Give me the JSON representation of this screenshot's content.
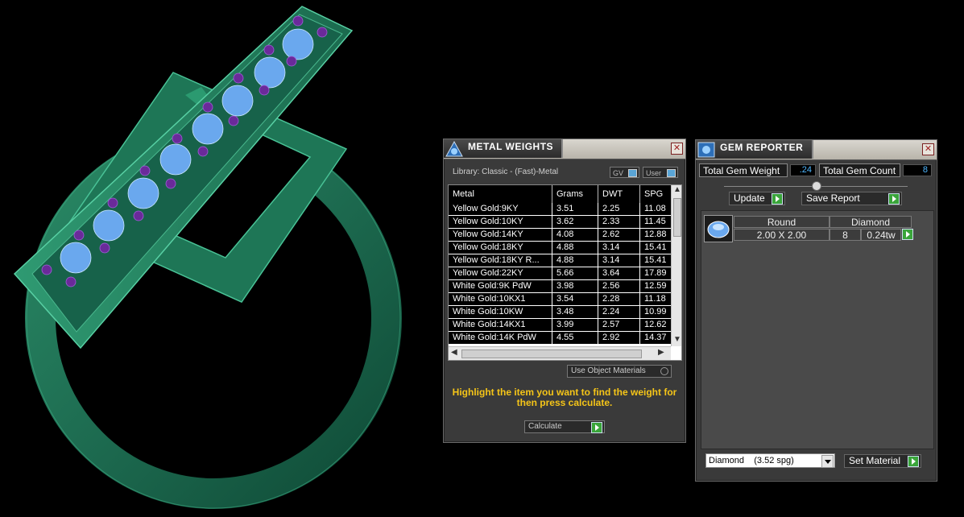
{
  "metal_panel": {
    "title": "METAL WEIGHTS",
    "library_label": "Library: Classic - (Fast)-Metal",
    "gv_toggle": "GV",
    "user_toggle": "User",
    "columns": [
      "Metal",
      "Grams",
      "DWT",
      "SPG"
    ],
    "rows": [
      [
        "Yellow Gold:9KY",
        "3.51",
        "2.25",
        "11.08"
      ],
      [
        "Yellow Gold:10KY",
        "3.62",
        "2.33",
        "11.45"
      ],
      [
        "Yellow Gold:14KY",
        "4.08",
        "2.62",
        "12.88"
      ],
      [
        "Yellow Gold:18KY",
        "4.88",
        "3.14",
        "15.41"
      ],
      [
        "Yellow Gold:18KY R...",
        "4.88",
        "3.14",
        "15.41"
      ],
      [
        "Yellow Gold:22KY",
        "5.66",
        "3.64",
        "17.89"
      ],
      [
        "White Gold:9K PdW",
        "3.98",
        "2.56",
        "12.59"
      ],
      [
        "White Gold:10KX1",
        "3.54",
        "2.28",
        "11.18"
      ],
      [
        "White Gold:10KW",
        "3.48",
        "2.24",
        "10.99"
      ],
      [
        "White Gold:14KX1",
        "3.99",
        "2.57",
        "12.62"
      ],
      [
        "White Gold:14K PdW",
        "4.55",
        "2.92",
        "14.37"
      ]
    ],
    "use_object_materials": "Use Object Materials",
    "hint": "Highlight the item you want to find the weight for then press calculate.",
    "calculate_label": "Calculate"
  },
  "gem_panel": {
    "title": "GEM REPORTER",
    "total_weight_label": "Total Gem Weight",
    "total_weight_value": ".24",
    "total_count_label": "Total Gem Count",
    "total_count_value": "8",
    "update_label": "Update",
    "save_report_label": "Save Report",
    "gem": {
      "shape": "Round",
      "material": "Diamond",
      "size": "2.00 X 2.00",
      "count": "8",
      "weight": "0.24tw"
    },
    "material_select": "Diamond    (3.52 spg)",
    "set_material_label": "Set Material"
  },
  "colors": {
    "ring_green": "#1f6e52",
    "gem_blue": "#6aa8ee",
    "prong_purple": "#6a2a9a",
    "hint_yellow": "#f5c518",
    "value_blue": "#4fb7ff"
  }
}
